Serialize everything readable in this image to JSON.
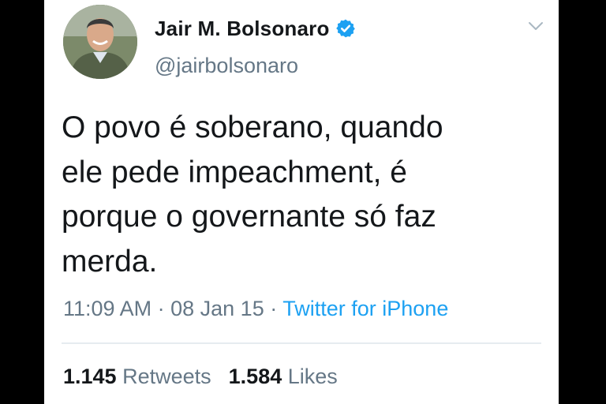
{
  "author": {
    "display_name": "Jair M. Bolsonaro",
    "handle": "@jairbolsonaro",
    "verified": true
  },
  "tweet": {
    "text": "O povo é soberano, quando\nele pede impeachment, é\nporque o governante só faz\nmerda.",
    "time": "11:09 AM",
    "date": "08 Jan 15",
    "separator": "·",
    "source": "Twitter for iPhone"
  },
  "stats": {
    "retweets_count": "1.145",
    "retweets_label": "Retweets",
    "likes_count": "1.584",
    "likes_label": "Likes"
  },
  "colors": {
    "brand_blue": "#1da1f2",
    "text_primary": "#14171a",
    "text_secondary": "#657786",
    "background": "#ffffff",
    "letterbox": "#000000"
  },
  "icons": {
    "verified": "verified-badge-icon",
    "menu": "chevron-down-icon"
  }
}
